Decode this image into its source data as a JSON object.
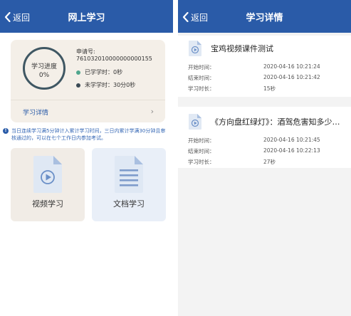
{
  "colors": {
    "nav_bg": "#2a5ba8",
    "accent_blue": "#2a5ba8",
    "studied_dot": "#4fa58d",
    "unstudied_dot": "#3a4a55",
    "ring": "#3f5763"
  },
  "left_screen": {
    "nav": {
      "back_label": "返回",
      "title": "网上学习"
    },
    "progress": {
      "ring_label": "学习进度",
      "ring_value": "0%",
      "percent": 0,
      "application_label": "申请号:",
      "application_number": "761032010000000000155",
      "studied": "已学学时：0秒",
      "unstudied": "未学学时：30分0秒",
      "detail_link": "学习详情"
    },
    "notice": "当日连续学习满5分钟计入累计学习时间，三日内累计学满30分钟且审核通过的，可以在七个工作日内参加考试。",
    "tiles": [
      {
        "label": "视频学习",
        "icon": "video-file-icon"
      },
      {
        "label": "文档学习",
        "icon": "document-icon"
      }
    ]
  },
  "right_screen": {
    "nav": {
      "back_label": "返回",
      "title": "学习详情"
    },
    "records": [
      {
        "icon": "video-file-icon",
        "title": "宝鸡视频课件测试",
        "start_label": "开始时间：",
        "start": "2020-04-16 10:21:24",
        "end_label": "结束时间：",
        "end": "2020-04-16 10:21:42",
        "duration_label": "学习时长：",
        "duration": "15秒"
      },
      {
        "icon": "video-file-icon",
        "title": "《方向盘红绿灯》：酒驾危害知多少…",
        "start_label": "开始时间：",
        "start": "2020-04-16 10:21:45",
        "end_label": "结束时间：",
        "end": "2020-04-16 10:22:13",
        "duration_label": "学习时长：",
        "duration": "27秒"
      }
    ]
  }
}
